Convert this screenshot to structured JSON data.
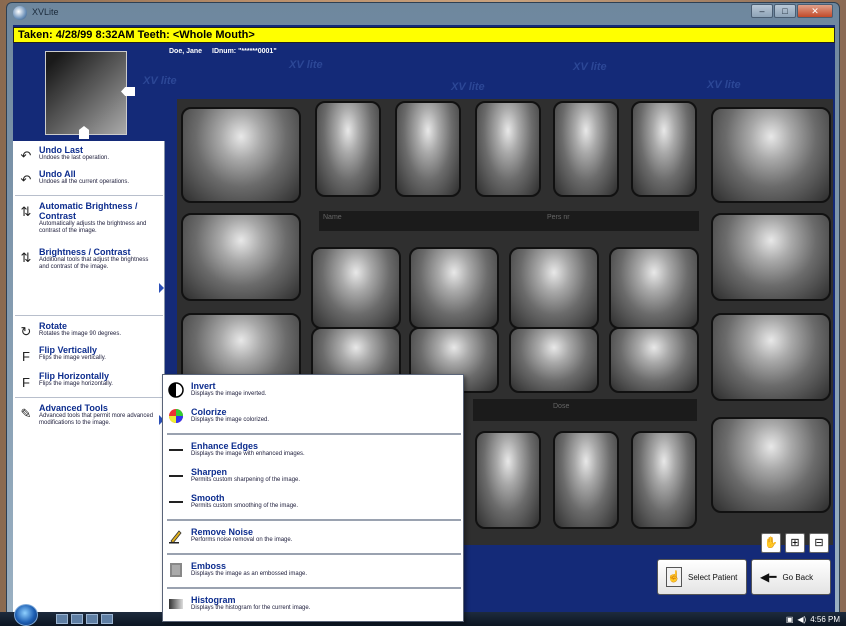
{
  "window": {
    "title": "XVLite",
    "min_label": "–",
    "max_label": "□",
    "close_label": "✕"
  },
  "info_bar": {
    "text": "Taken: 4/28/99  8:32AM  Teeth: <Whole Mouth>"
  },
  "patient": {
    "name": "Doe, Jane",
    "id_label": "IDnum: \"******0001\""
  },
  "watermark_text": "XV lite",
  "xray_labels": {
    "name_label": "Name",
    "pers_label": "Pers nr",
    "dose_label": "Dose"
  },
  "tools": [
    {
      "title": "Undo Last",
      "desc": "Undoes the last operation.",
      "icon": "undo-icon",
      "glyph": "↶"
    },
    {
      "title": "Undo All",
      "desc": "Undoes all the current operations.",
      "icon": "undo-all-icon",
      "glyph": "↶"
    },
    {
      "title": "Automatic Brightness / Contrast",
      "desc": "Automatically adjusts the brightness and contrast of the image.",
      "icon": "auto-brightness-icon",
      "glyph": "⇅"
    },
    {
      "title": "Brightness / Contrast",
      "desc": "Additional tools that adjust the brightness and contrast of the image.",
      "icon": "brightness-icon",
      "glyph": "⇅"
    },
    {
      "title": "Rotate",
      "desc": "Rotates the image 90 degrees.",
      "icon": "rotate-icon",
      "glyph": "↻"
    },
    {
      "title": "Flip Vertically",
      "desc": "Flips the image vertically.",
      "icon": "flip-vertical-icon",
      "glyph": "F"
    },
    {
      "title": "Flip Horizontally",
      "desc": "Flips the image horizontally.",
      "icon": "flip-horizontal-icon",
      "glyph": "F"
    },
    {
      "title": "Advanced Tools",
      "desc": "Advanced tools that permit more advanced modifications to the image.",
      "icon": "pencil-icon",
      "glyph": "✎"
    }
  ],
  "advanced_menu": [
    {
      "title": "Invert",
      "desc": "Displays the image inverted."
    },
    {
      "title": "Colorize",
      "desc": "Displays the image colorized."
    },
    {
      "title": "Enhance Edges",
      "desc": "Displays the image with enhanced images."
    },
    {
      "title": "Sharpen",
      "desc": "Permits custom sharpening of the image."
    },
    {
      "title": "Smooth",
      "desc": "Permits custom smoothing of the image."
    },
    {
      "title": "Remove Noise",
      "desc": "Performs noise removal on the image."
    },
    {
      "title": "Emboss",
      "desc": "Displays the image as an embossed image."
    },
    {
      "title": "Histogram",
      "desc": "Displays the histogram for the current image."
    }
  ],
  "buttons": {
    "select_patient": "Select Patient",
    "go_back": "Go Back"
  },
  "taskbar": {
    "clock": "4:56 PM"
  },
  "colors": {
    "background": "#142a78",
    "info_bar": "#ffff00",
    "tool_title": "#0d2d8e"
  }
}
